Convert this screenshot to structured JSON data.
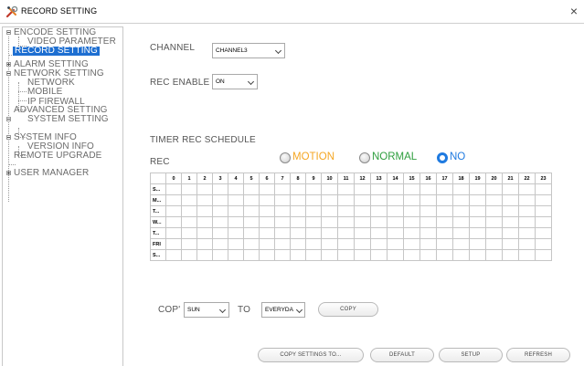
{
  "window": {
    "title": "RECORD SETTING",
    "close_glyph": "×",
    "icon": "tools-icon"
  },
  "tree": [
    {
      "label": "ENCODE SETTING"
    },
    {
      "label": "VIDEO PARAMETER"
    },
    {
      "label": "RECORD SETTING"
    },
    {
      "label": "ALARM SETTING"
    },
    {
      "label": "NETWORK SETTING"
    },
    {
      "label": "NETWORK"
    },
    {
      "label": "MOBILE"
    },
    {
      "label": "IP FIREWALL"
    },
    {
      "label": "ADVANCED SETTING"
    },
    {
      "label": "SYSTEM SETTING"
    },
    {
      "label": "SYSTEM INFO"
    },
    {
      "label": "VERSION INFO"
    },
    {
      "label": "REMOTE UPGRADE"
    },
    {
      "label": "USER MANAGER"
    }
  ],
  "form": {
    "channel_label": "CHANNEL",
    "channel_value": "CHANNEL3",
    "rec_enable_label": "REC ENABLE",
    "rec_enable_value": "ON",
    "timer_title": "TIMER REC SCHEDULE",
    "rec_label": "REC"
  },
  "modes": [
    {
      "label": "MOTION",
      "color": "#f5a623",
      "checked": false
    },
    {
      "label": "NORMAL",
      "color": "#2e9e3e",
      "checked": false
    },
    {
      "label": "NO",
      "color": "#1f7ae0",
      "checked": true
    }
  ],
  "schedule": {
    "hours": [
      "0",
      "1",
      "2",
      "3",
      "4",
      "5",
      "6",
      "7",
      "8",
      "9",
      "10",
      "11",
      "12",
      "13",
      "14",
      "15",
      "16",
      "17",
      "18",
      "19",
      "20",
      "21",
      "22",
      "23"
    ],
    "days": [
      "S...",
      "M...",
      "T...",
      "W...",
      "T...",
      "FRI",
      "S..."
    ]
  },
  "copy": {
    "label": "COP'",
    "from_value": "SUN",
    "to_label": "TO",
    "to_value": "EVERYDA",
    "copy_button": "COPY"
  },
  "footer": {
    "copy_settings": "COPY SETTINGS TO...",
    "default": "DEFAULT",
    "setup": "SETUP",
    "refresh": "REFRESH"
  }
}
